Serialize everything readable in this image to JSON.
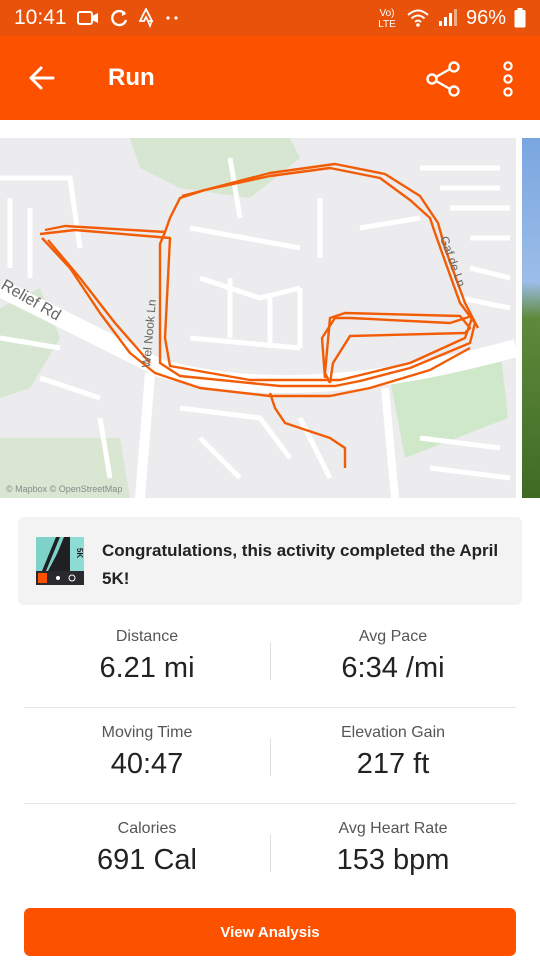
{
  "status_bar": {
    "time": "10:41",
    "battery": "96%",
    "lte_label": "LTE",
    "volte_label": "Vo)"
  },
  "app_bar": {
    "title": "Run"
  },
  "map": {
    "road_label_relief": "Relief Rd",
    "road_label_vertical": "Wel Nook Ln",
    "road_label_right": "Gaf de Ln",
    "attribution": "© Mapbox © OpenStreetMap",
    "route_color": "#f25c05"
  },
  "challenge": {
    "text": "Congratulations, this activity completed the April 5K!",
    "badge_label": "5K"
  },
  "stats": {
    "distance_label": "Distance",
    "distance_value": "6.21 mi",
    "pace_label": "Avg Pace",
    "pace_value": "6:34 /mi",
    "moving_time_label": "Moving Time",
    "moving_time_value": "40:47",
    "elevation_label": "Elevation Gain",
    "elevation_value": "217 ft",
    "calories_label": "Calories",
    "calories_value": "691 Cal",
    "heart_rate_label": "Avg Heart Rate",
    "heart_rate_value": "153 bpm"
  },
  "actions": {
    "view_analysis": "View Analysis"
  },
  "colors": {
    "brand": "#fc5200",
    "status_bar": "#e8520a"
  }
}
